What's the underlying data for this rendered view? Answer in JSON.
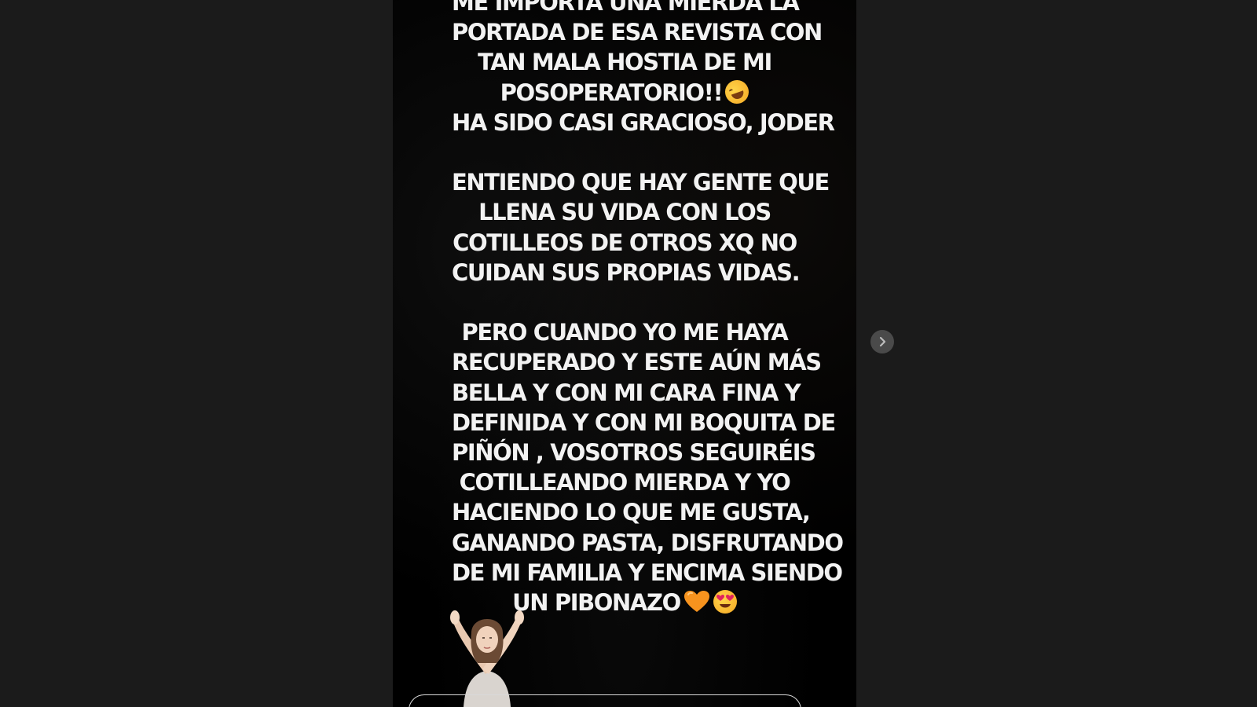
{
  "story": {
    "paragraphs": [
      {
        "lines": [
          {
            "text": "ME IMPORTA UNA MIERDA LA"
          },
          {
            "text": "PORTADA DE ESA REVISTA CON"
          },
          {
            "text": "TAN MALA HOSTIA DE MI"
          },
          {
            "text": "POSOPERATORIO!!",
            "emoji": "rolling-on-floor-laughing"
          },
          {
            "text": "HA SIDO CASI GRACIOSO, JODER"
          }
        ]
      },
      {
        "lines": [
          {
            "text": "ENTIENDO QUE HAY GENTE QUE"
          },
          {
            "text": "LLENA SU VIDA CON LOS"
          },
          {
            "text": "COTILLEOS DE OTROS XQ NO"
          },
          {
            "text": "CUIDAN SUS PROPIAS VIDAS."
          }
        ]
      },
      {
        "lines": [
          {
            "text": "PERO CUANDO YO ME HAYA"
          },
          {
            "text": "RECUPERADO Y ESTE AÚN MÁS"
          },
          {
            "text": "BELLA Y CON MI CARA FINA Y"
          },
          {
            "text": "DEFINIDA Y CON MI BOQUITA DE"
          },
          {
            "text": "PIÑÓN , VOSOTROS SEGUIRÉIS"
          },
          {
            "text": "COTILLEANDO MIERDA Y YO"
          },
          {
            "text": "HACIENDO LO QUE ME GUSTA,"
          },
          {
            "text": "GANANDO PASTA, DISFRUTANDO"
          },
          {
            "text": "DE MI FAMILIA Y ENCIMA SIENDO"
          },
          {
            "text": "UN PIBONAZO",
            "emoji": "orange-heart+heart-eyes"
          }
        ]
      }
    ],
    "sticker": "woman-crossed-arms-sticker"
  },
  "controls": {
    "next_icon": "chevron-right-icon",
    "send_icon": "send-icon"
  },
  "colors": {
    "page_background": "#1b1b1b",
    "story_background": "#000000",
    "text": "#f2f2f2",
    "next_button": "#4a4a4a",
    "heart": "#f7931e"
  }
}
